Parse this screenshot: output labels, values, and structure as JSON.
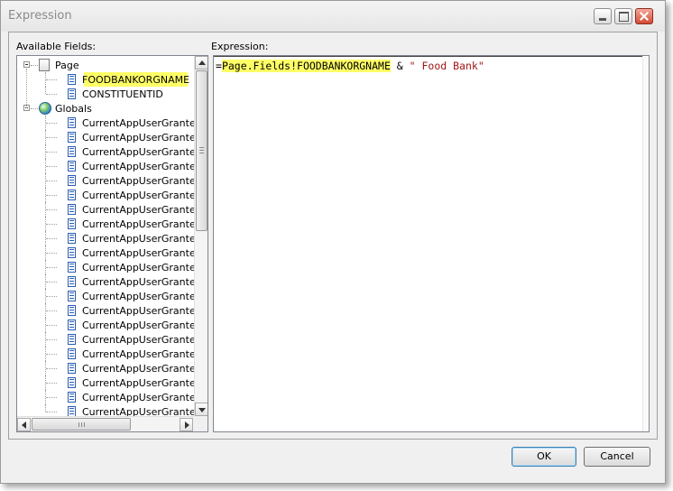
{
  "window": {
    "title": "Expression",
    "minimize_label": "Minimize",
    "maximize_label": "Maximize",
    "close_label": "Close"
  },
  "fields_panel": {
    "label": "Available Fields:",
    "tree": [
      {
        "label": "Page",
        "level": 0,
        "icon": "page-icon",
        "expanded": true
      },
      {
        "label": "FOODBANKORGNAME",
        "level": 1,
        "icon": "field-icon",
        "selected": true
      },
      {
        "label": "CONSTITUENTID",
        "level": 1,
        "icon": "field-icon"
      },
      {
        "label": "Globals",
        "level": 0,
        "icon": "globe-icon",
        "expanded": true
      },
      {
        "label": "CurrentAppUserGrantedBat",
        "level": 1,
        "icon": "field-icon"
      },
      {
        "label": "CurrentAppUserGrantedBat",
        "level": 1,
        "icon": "field-icon"
      },
      {
        "label": "CurrentAppUserGrantedBat",
        "level": 1,
        "icon": "field-icon"
      },
      {
        "label": "CurrentAppUserGrantedBat",
        "level": 1,
        "icon": "field-icon"
      },
      {
        "label": "CurrentAppUserGrantedBat",
        "level": 1,
        "icon": "field-icon"
      },
      {
        "label": "CurrentAppUserGrantedBus",
        "level": 1,
        "icon": "field-icon"
      },
      {
        "label": "CurrentAppUserGrantedCo",
        "level": 1,
        "icon": "field-icon"
      },
      {
        "label": "CurrentAppUserGrantedCo",
        "level": 1,
        "icon": "field-icon"
      },
      {
        "label": "CurrentAppUserGrantedCo",
        "level": 1,
        "icon": "field-icon"
      },
      {
        "label": "CurrentAppUserGrantedDa",
        "level": 1,
        "icon": "field-icon"
      },
      {
        "label": "CurrentAppUserGrantedDa",
        "level": 1,
        "icon": "field-icon"
      },
      {
        "label": "CurrentAppUserGrantedFor",
        "level": 1,
        "icon": "field-icon"
      },
      {
        "label": "CurrentAppUserGrantedGlo",
        "level": 1,
        "icon": "field-icon"
      },
      {
        "label": "CurrentAppUserGrantedKpi",
        "level": 1,
        "icon": "field-icon"
      },
      {
        "label": "CurrentAppUserGrantedMe",
        "level": 1,
        "icon": "field-icon"
      },
      {
        "label": "CurrentAppUserGrantedPag",
        "level": 1,
        "icon": "field-icon"
      },
      {
        "label": "CurrentAppUserGrantedQu",
        "level": 1,
        "icon": "field-icon"
      },
      {
        "label": "CurrentAppUserGrantedRe",
        "level": 1,
        "icon": "field-icon"
      },
      {
        "label": "CurrentAppUserGrantedRep",
        "level": 1,
        "icon": "field-icon"
      },
      {
        "label": "CurrentAppUserGrantedSim",
        "level": 1,
        "icon": "field-icon"
      },
      {
        "label": "CurrentAppUserGrantedSm",
        "level": 1,
        "icon": "field-icon"
      }
    ]
  },
  "expression_panel": {
    "label": "Expression:",
    "prefix": "=",
    "highlighted": "Page.Fields!FOODBANKORGNAME",
    "operator": " & ",
    "string_literal": "\" Food Bank\""
  },
  "buttons": {
    "ok": "OK",
    "cancel": "Cancel"
  },
  "colors": {
    "highlight": "#ffff66",
    "string_literal": "#a31515"
  }
}
